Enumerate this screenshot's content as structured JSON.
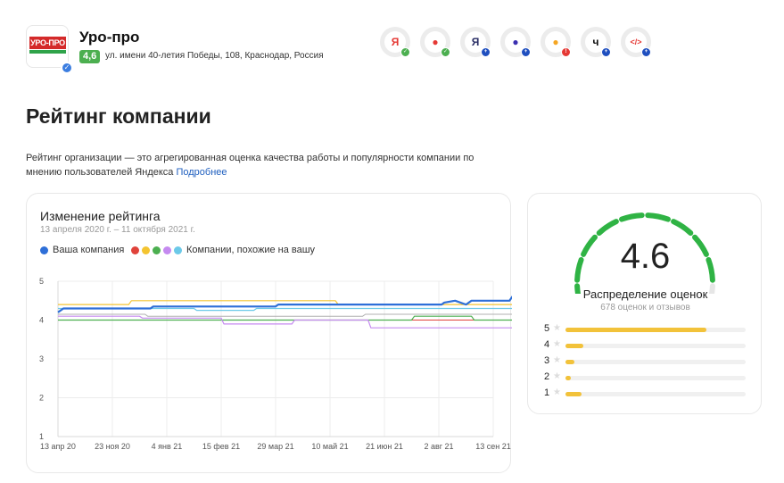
{
  "company": {
    "logo_text": "УРО-ПРО",
    "name": "Уро-про",
    "rating": "4,6",
    "address": "ул. имени 40-летия Победы, 108, Краснодар, Россия"
  },
  "services": [
    {
      "icon": "yandex-letter-icon",
      "glyph": "Я",
      "glyph_color": "#e53935",
      "status": "ok",
      "status_color": "#4caf50"
    },
    {
      "icon": "map-pin-icon",
      "glyph": "●",
      "glyph_color": "#e53935",
      "status": "ok",
      "status_color": "#4caf50"
    },
    {
      "icon": "yandex-browser-icon",
      "glyph": "Я",
      "glyph_color": "#2b2f66",
      "status": "add",
      "status_color": "#1f4fbf"
    },
    {
      "icon": "alice-icon",
      "glyph": "●",
      "glyph_color": "#3b2fb0",
      "status": "add",
      "status_color": "#1f4fbf"
    },
    {
      "icon": "yandex-go-icon",
      "glyph": "●",
      "glyph_color": "#f5a623",
      "status": "warning",
      "status_color": "#e53935"
    },
    {
      "icon": "yandex-q-icon",
      "glyph": "ч",
      "glyph_color": "#111111",
      "status": "add",
      "status_color": "#1f4fbf"
    },
    {
      "icon": "code-widget-icon",
      "glyph": "</>",
      "glyph_color": "#e53935",
      "status": "add",
      "status_color": "#1f4fbf"
    }
  ],
  "page": {
    "title": "Рейтинг компании",
    "description": "Рейтинг организации — это агрегированная оценка качества работы и популярности компании по мнению пользователей Яндекса",
    "more_link": "Подробнее"
  },
  "chart": {
    "title": "Изменение рейтинга",
    "period": "13 апреля 2020 г. – 11 октября 2021 г.",
    "legend_own": "Ваша компания",
    "legend_similar": "Компании, похожие на вашу",
    "own_color": "#2e6fd8",
    "similar_colors": [
      "#e0433b",
      "#f4c430",
      "#4caf50",
      "#c58af0",
      "#6cc9e8"
    ]
  },
  "chart_data": {
    "type": "line",
    "x": [
      "13 апр 20",
      "23 ноя 20",
      "4 янв 21",
      "15 фев 21",
      "29 мар 21",
      "10 май 21",
      "21 июн 21",
      "2 авг 21",
      "13 сен 21"
    ],
    "ylim": [
      1,
      5
    ],
    "yticks": [
      "1",
      "2",
      "3",
      "4",
      "5"
    ],
    "xlabel": "",
    "ylabel": "",
    "grid": true,
    "series": [
      {
        "name": "Ваша компания",
        "color": "#2e6fd8",
        "width": 2.2,
        "points": [
          [
            0,
            4.2
          ],
          [
            0.1,
            4.3
          ],
          [
            1.7,
            4.3
          ],
          [
            1.75,
            4.35
          ],
          [
            4.0,
            4.35
          ],
          [
            4.05,
            4.4
          ],
          [
            7.05,
            4.4
          ],
          [
            7.1,
            4.45
          ],
          [
            7.3,
            4.5
          ],
          [
            7.5,
            4.4
          ],
          [
            7.6,
            4.5
          ],
          [
            8.3,
            4.5
          ],
          [
            8.35,
            4.6
          ],
          [
            8.8,
            4.6
          ]
        ]
      },
      {
        "color": "#f4c430",
        "width": 1.2,
        "points": [
          [
            0,
            4.4
          ],
          [
            1.3,
            4.4
          ],
          [
            1.35,
            4.5
          ],
          [
            5.1,
            4.5
          ],
          [
            5.15,
            4.4
          ],
          [
            8.8,
            4.4
          ]
        ]
      },
      {
        "color": "#6cc9e8",
        "width": 1.2,
        "points": [
          [
            0,
            4.3
          ],
          [
            2.5,
            4.3
          ],
          [
            2.55,
            4.25
          ],
          [
            3.6,
            4.25
          ],
          [
            3.65,
            4.3
          ],
          [
            8.8,
            4.3
          ]
        ]
      },
      {
        "color": "#c58af0",
        "width": 1.2,
        "points": [
          [
            0,
            4.1
          ],
          [
            1.5,
            4.1
          ],
          [
            1.55,
            4.05
          ],
          [
            3.0,
            4.05
          ],
          [
            3.05,
            3.9
          ],
          [
            4.3,
            3.9
          ],
          [
            4.35,
            4.0
          ],
          [
            5.7,
            4.0
          ],
          [
            5.75,
            3.8
          ],
          [
            8.8,
            3.8
          ]
        ]
      },
      {
        "color": "#4caf50",
        "width": 1.2,
        "points": [
          [
            0,
            4.0
          ],
          [
            6.5,
            4.0
          ],
          [
            6.55,
            4.1
          ],
          [
            7.6,
            4.1
          ],
          [
            7.65,
            4.0
          ],
          [
            8.8,
            4.0
          ]
        ]
      },
      {
        "color": "#e0433b",
        "width": 1.0,
        "points": [
          [
            0,
            4.0
          ],
          [
            8.8,
            4.0
          ]
        ]
      },
      {
        "color": "#b0b0b0",
        "width": 1.0,
        "points": [
          [
            0,
            4.15
          ],
          [
            1.6,
            4.15
          ],
          [
            1.65,
            4.1
          ],
          [
            5.6,
            4.1
          ],
          [
            5.65,
            4.15
          ],
          [
            8.8,
            4.15
          ]
        ]
      }
    ]
  },
  "distribution": {
    "rating": "4.6",
    "title": "Распределение оценок",
    "subtitle": "678 оценок и отзывов",
    "rows": [
      {
        "stars": "5",
        "fraction": 0.78
      },
      {
        "stars": "4",
        "fraction": 0.1
      },
      {
        "stars": "3",
        "fraction": 0.05
      },
      {
        "stars": "2",
        "fraction": 0.03
      },
      {
        "stars": "1",
        "fraction": 0.09
      }
    ],
    "gauge_color": "#2fb344",
    "gauge_empty_color": "#e6e6e6",
    "bar_color": "#f2c23a"
  }
}
